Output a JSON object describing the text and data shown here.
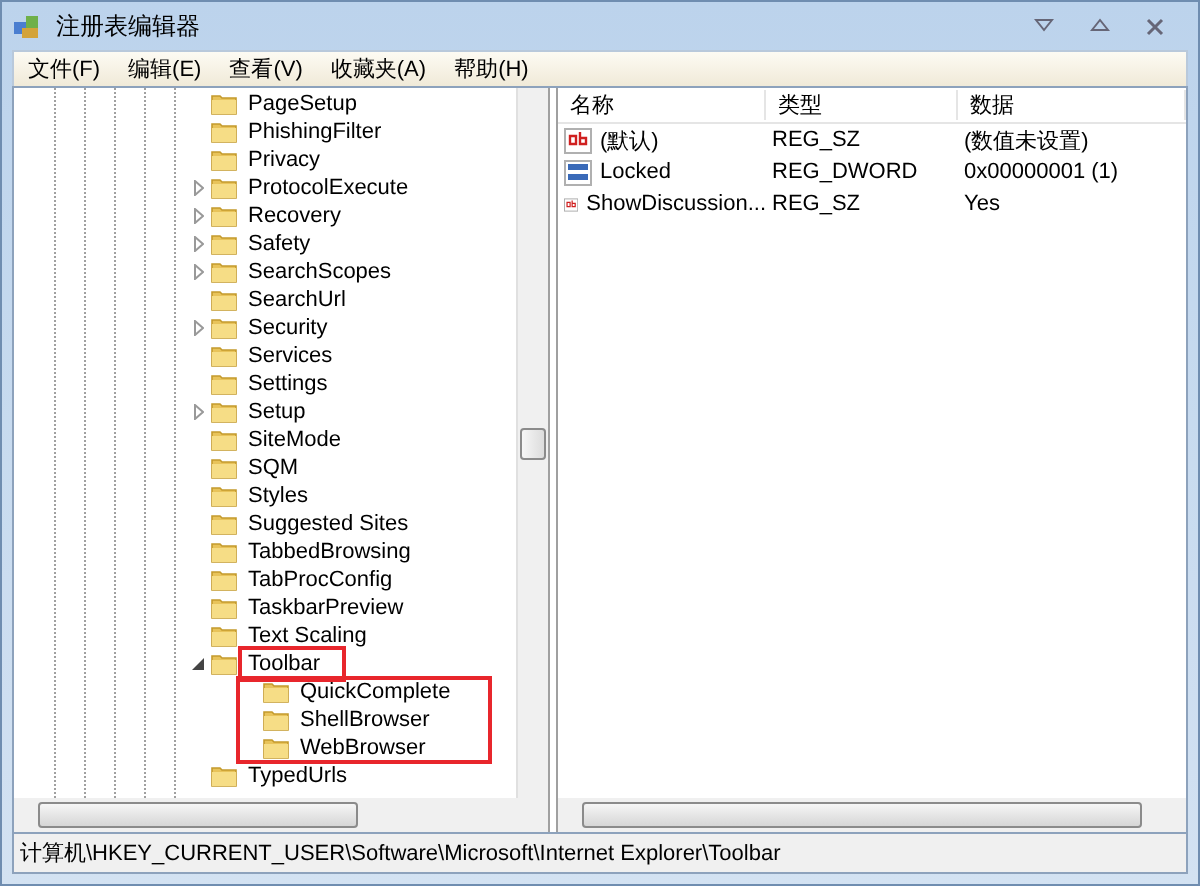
{
  "window": {
    "title": "注册表编辑器"
  },
  "menu": [
    "文件(F)",
    "编辑(E)",
    "查看(V)",
    "收藏夹(A)",
    "帮助(H)"
  ],
  "tree": [
    {
      "label": "PageSetup",
      "expandable": false
    },
    {
      "label": "PhishingFilter",
      "expandable": false
    },
    {
      "label": "Privacy",
      "expandable": false
    },
    {
      "label": "ProtocolExecute",
      "expandable": true
    },
    {
      "label": "Recovery",
      "expandable": true
    },
    {
      "label": "Safety",
      "expandable": true
    },
    {
      "label": "SearchScopes",
      "expandable": true
    },
    {
      "label": "SearchUrl",
      "expandable": false
    },
    {
      "label": "Security",
      "expandable": true
    },
    {
      "label": "Services",
      "expandable": false
    },
    {
      "label": "Settings",
      "expandable": false
    },
    {
      "label": "Setup",
      "expandable": true
    },
    {
      "label": "SiteMode",
      "expandable": false
    },
    {
      "label": "SQM",
      "expandable": false
    },
    {
      "label": "Styles",
      "expandable": false
    },
    {
      "label": "Suggested Sites",
      "expandable": false
    },
    {
      "label": "TabbedBrowsing",
      "expandable": false
    },
    {
      "label": "TabProcConfig",
      "expandable": false
    },
    {
      "label": "TaskbarPreview",
      "expandable": false
    },
    {
      "label": "Text Scaling",
      "expandable": false
    },
    {
      "label": "Toolbar",
      "expandable": true,
      "expanded": true,
      "highlighted": true,
      "children_highlighted": true,
      "children": [
        {
          "label": "QuickComplete",
          "expandable": false
        },
        {
          "label": "ShellBrowser",
          "expandable": false
        },
        {
          "label": "WebBrowser",
          "expandable": false
        }
      ]
    },
    {
      "label": "TypedUrls",
      "expandable": false
    }
  ],
  "values": {
    "columns": [
      "名称",
      "类型",
      "数据"
    ],
    "rows": [
      {
        "kind": "string",
        "name": "(默认)",
        "type": "REG_SZ",
        "data": "(数值未设置)"
      },
      {
        "kind": "binary",
        "name": "Locked",
        "type": "REG_DWORD",
        "data": "0x00000001 (1)"
      },
      {
        "kind": "string",
        "name": "ShowDiscussion...",
        "type": "REG_SZ",
        "data": "Yes"
      }
    ]
  },
  "status_bar": "计算机\\HKEY_CURRENT_USER\\Software\\Microsoft\\Internet Explorer\\Toolbar"
}
